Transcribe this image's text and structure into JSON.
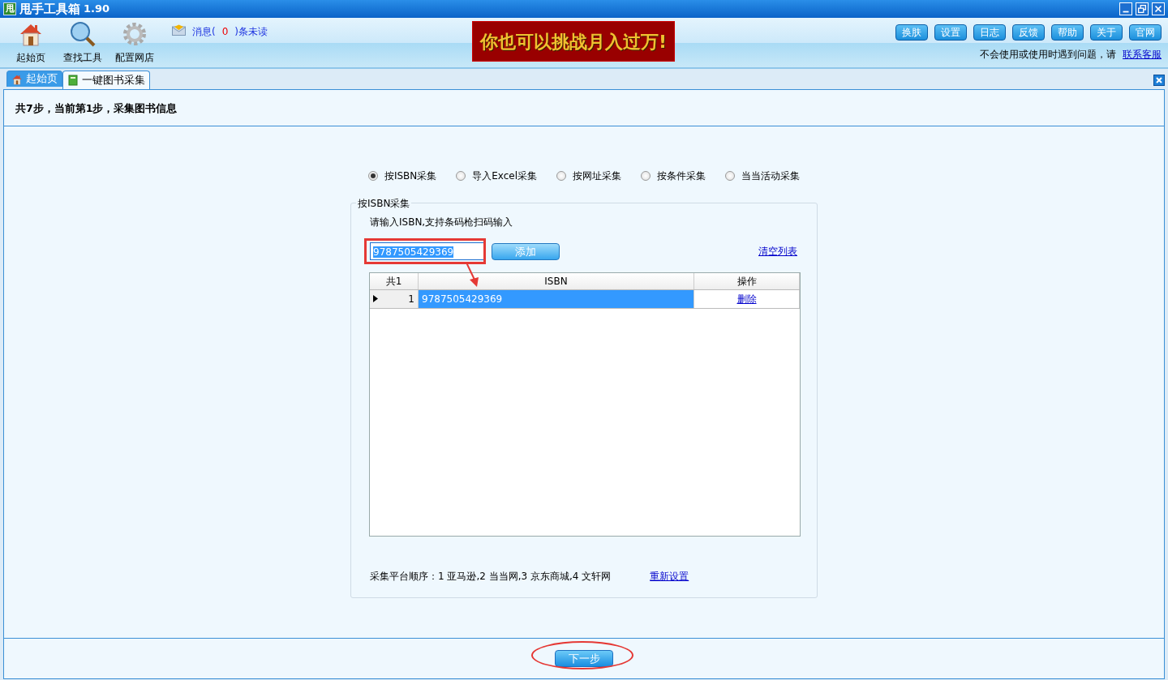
{
  "window": {
    "app_icon_letter": "甩",
    "title": "甩手工具箱",
    "version": "1.90"
  },
  "toolbar": {
    "tools": [
      {
        "label": "起始页",
        "kind": "home"
      },
      {
        "label": "查找工具",
        "kind": "search"
      },
      {
        "label": "配置网店",
        "kind": "settings"
      }
    ],
    "messages": {
      "prefix": "消息(",
      "count": "0",
      "suffix": ")条未读"
    },
    "banner": "你也可以挑战月入过万!",
    "buttons": [
      "换肤",
      "设置",
      "日志",
      "反馈",
      "帮助",
      "关于",
      "官网"
    ],
    "help_text": "不会使用或使用时遇到问题，请",
    "help_link": "联系客服"
  },
  "tabs": [
    {
      "label": "起始页",
      "kind": "home",
      "selected": false
    },
    {
      "label": "一键图书采集",
      "kind": "book",
      "selected": true
    }
  ],
  "step_header": "共7步，当前第1步，采集图书信息",
  "collect_modes": [
    {
      "label": "按ISBN采集",
      "selected": true
    },
    {
      "label": "导入Excel采集",
      "selected": false
    },
    {
      "label": "按网址采集",
      "selected": false
    },
    {
      "label": "按条件采集",
      "selected": false
    },
    {
      "label": "当当活动采集",
      "selected": false
    }
  ],
  "isbn_group": {
    "legend": "按ISBN采集",
    "hint": "请输入ISBN,支持条码枪扫码输入",
    "input_value": "9787505429369",
    "add_button": "添加",
    "clear_link": "清空列表",
    "table": {
      "columns": [
        "共1",
        "ISBN",
        "操作"
      ],
      "rows": [
        {
          "index": "1",
          "isbn": "9787505429369",
          "action": "删除",
          "selected": true
        }
      ]
    },
    "platform_order": "采集平台顺序：1 亚马逊,2 当当网,3 京东商城,4 文轩网",
    "reset_link": "重新设置"
  },
  "next_button": "下一步"
}
